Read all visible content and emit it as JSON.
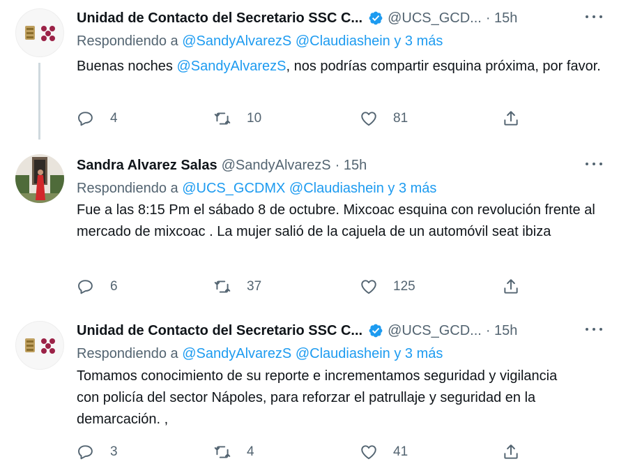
{
  "tweets": [
    {
      "author_name": "Unidad de Contacto del Secretario SSC C...",
      "handle": "@UCS_GCD...",
      "time": "· 15h",
      "verified": true,
      "reply_prefix": "Respondiendo a ",
      "reply_links": "@SandyAlvarezS @Claudiashein y 3 más",
      "text_pre": "Buenas noches ",
      "text_link": "@SandyAlvarezS",
      "text_post": ", nos podrías compartir esquina próxima, por favor.",
      "replies": "4",
      "retweets": "10",
      "likes": "81"
    },
    {
      "author_name": "Sandra Alvarez Salas",
      "handle": "@SandyAlvarezS",
      "time": "· 15h",
      "verified": false,
      "reply_prefix": "Respondiendo a ",
      "reply_links": "@UCS_GCDMX @Claudiashein y 3 más",
      "text": "Fue a las 8:15 Pm el sábado 8 de octubre. Mixcoac esquina con revolución frente al mercado de mixcoac . La mujer salió de la cajuela de un automóvil seat ibiza",
      "replies": "6",
      "retweets": "37",
      "likes": "125"
    },
    {
      "author_name": "Unidad de Contacto del Secretario SSC C...",
      "handle": "@UCS_GCD...",
      "time": "· 15h",
      "verified": true,
      "reply_prefix": "Respondiendo a ",
      "reply_links": "@SandyAlvarezS @Claudiashein y 3 más",
      "text": "Tomamos conocimiento de su reporte e incrementamos seguridad y vigilancia con policía del sector Nápoles, para reforzar el patrullaje y seguridad en la demarcación. ,",
      "replies": "3",
      "retweets": "4",
      "likes": "41"
    }
  ],
  "icons": {
    "reply": "reply-icon",
    "retweet": "retweet-icon",
    "like": "heart-icon",
    "share": "share-icon",
    "more": "more-icon",
    "verified": "verified-badge-icon"
  },
  "colors": {
    "link": "#1d9bf0",
    "secondary": "#536471",
    "text": "#0f1419",
    "thread_line": "#cfd9de"
  }
}
